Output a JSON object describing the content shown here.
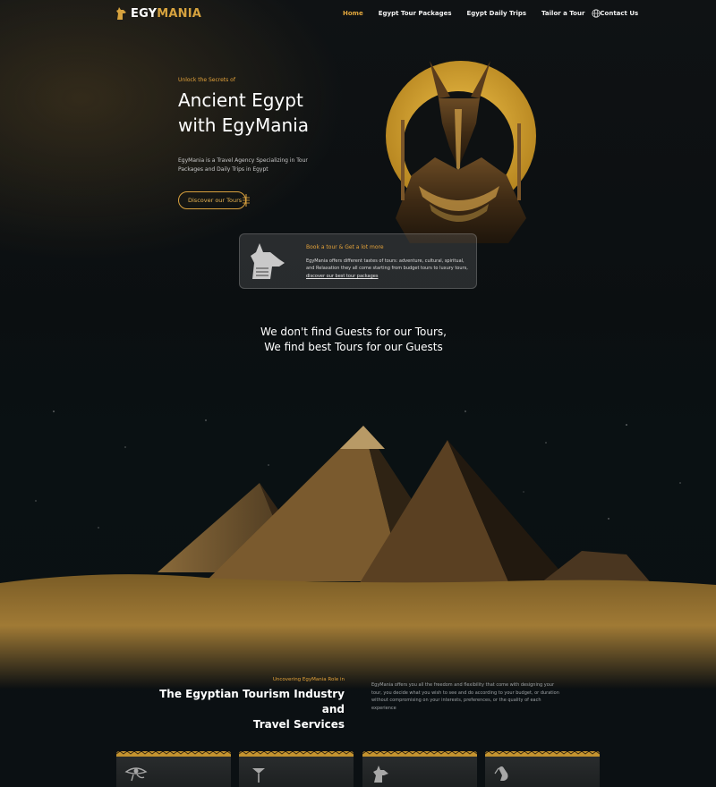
{
  "brand": {
    "name_part1": "EGY",
    "name_part2": "MANIA"
  },
  "nav": {
    "links": [
      {
        "label": "Home",
        "active": true
      },
      {
        "label": "Egypt Tour Packages",
        "active": false
      },
      {
        "label": "Egypt Daily Trips",
        "active": false
      },
      {
        "label": "Tailor a Tour",
        "active": false
      },
      {
        "label": "Contact Us",
        "active": false
      }
    ],
    "language_icon": "globe-icon"
  },
  "hero": {
    "eyebrow": "Unlock the Secrets of",
    "title_line1": "Ancient Egypt",
    "title_line2": "with EgyMania",
    "description": "EgyMania is a Travel Agency Specializing in Tour Packages and Daily Trips in Egypt",
    "cta_label": "Discover our Tours",
    "image": "anubis-statue"
  },
  "info_card": {
    "title": "Book a tour & Get a lot more",
    "text": "EgyMania offers different tastes of tours: adventure, cultural, spiritual, and Relaxation they all come starting from budget tours to luxury tours,",
    "link_label": "discover our best tour packages",
    "icon": "anubis-head-icon"
  },
  "tagline": {
    "line1": "We don't find Guests for our Tours,",
    "line2": "We find best Tours for our Guests"
  },
  "role": {
    "eyebrow": "Uncovering EgyMania Role in",
    "title_line1": "The Egyptian Tourism Industry and",
    "title_line2": "Travel Services",
    "description": "EgyMania offers you all the freedom and flexibility that come with designing your tour, you decide what you wish to see and do according to your budget, or duration without compromising on your interests, preferences, or the quality of each experience"
  },
  "features": {
    "icons": [
      "eye-of-horus-icon",
      "papyrus-icon",
      "anubis-icon",
      "ibis-icon"
    ]
  },
  "colors": {
    "accent": "#e3a23a",
    "background": "#0b0f11",
    "text": "#ffffff"
  }
}
